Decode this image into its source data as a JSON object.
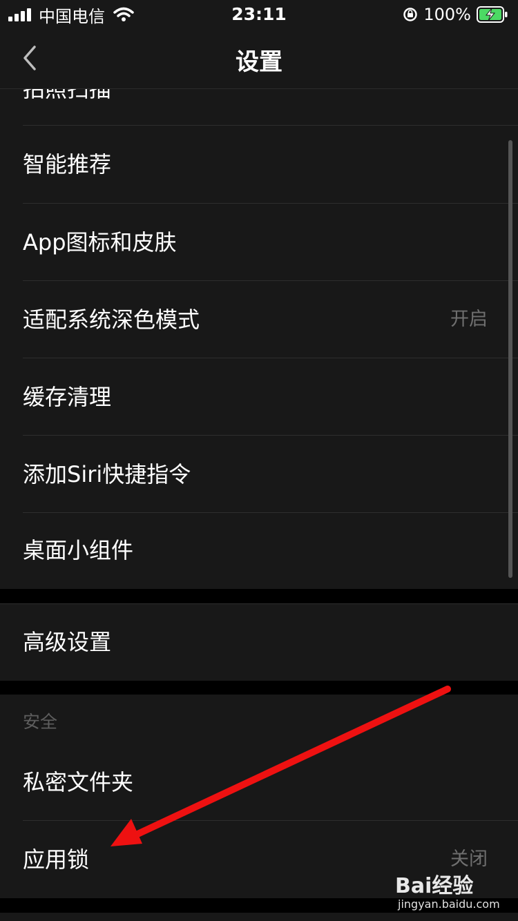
{
  "status_bar": {
    "carrier": "中国电信",
    "time": "23:11",
    "battery": "100%"
  },
  "nav": {
    "title": "设置"
  },
  "settings": {
    "partial_item": "拍照扫描",
    "group1": [
      {
        "label": "智能推荐",
        "value": ""
      },
      {
        "label": "App图标和皮肤",
        "value": ""
      },
      {
        "label": "适配系统深色模式",
        "value": "开启"
      },
      {
        "label": "缓存清理",
        "value": ""
      },
      {
        "label": "添加Siri快捷指令",
        "value": ""
      },
      {
        "label": "桌面小组件",
        "value": ""
      }
    ],
    "advanced": {
      "label": "高级设置"
    },
    "security": {
      "header": "安全",
      "items": [
        {
          "label": "私密文件夹",
          "value": ""
        },
        {
          "label": "应用锁",
          "value": "关闭"
        }
      ]
    }
  },
  "watermark": {
    "logo": "Bai经验",
    "url": "jingyan.baidu.com"
  },
  "colors": {
    "background": "#000000",
    "row_background": "#181818",
    "value_text": "#6f6f6f",
    "arrow": "#ee1111",
    "battery_charging": "#4cd964"
  }
}
